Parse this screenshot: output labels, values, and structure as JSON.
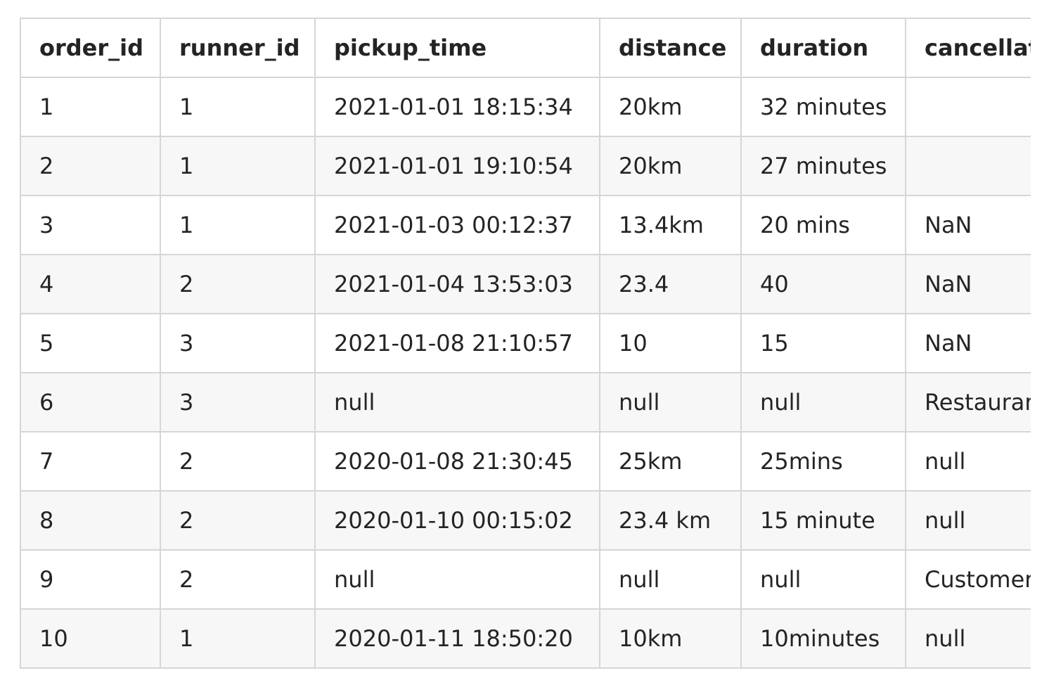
{
  "table": {
    "headers": [
      "order_id",
      "runner_id",
      "pickup_time",
      "distance",
      "duration",
      "cancellat"
    ],
    "rows": [
      [
        "1",
        "1",
        "2021-01-01 18:15:34",
        "20km",
        "32 minutes",
        ""
      ],
      [
        "2",
        "1",
        "2021-01-01 19:10:54",
        "20km",
        "27 minutes",
        ""
      ],
      [
        "3",
        "1",
        "2021-01-03 00:12:37",
        "13.4km",
        "20 mins",
        "NaN"
      ],
      [
        "4",
        "2",
        "2021-01-04 13:53:03",
        "23.4",
        "40",
        "NaN"
      ],
      [
        "5",
        "3",
        "2021-01-08 21:10:57",
        "10",
        "15",
        "NaN"
      ],
      [
        "6",
        "3",
        "null",
        "null",
        "null",
        "Restaurar"
      ],
      [
        "7",
        "2",
        "2020-01-08 21:30:45",
        "25km",
        "25mins",
        "null"
      ],
      [
        "8",
        "2",
        "2020-01-10 00:15:02",
        "23.4 km",
        "15 minute",
        "null"
      ],
      [
        "9",
        "2",
        "null",
        "null",
        "null",
        "Customer"
      ],
      [
        "10",
        "1",
        "2020-01-11 18:50:20",
        "10km",
        "10minutes",
        "null"
      ]
    ]
  },
  "colors": {
    "border": "#d6d6d6",
    "stripe": "#f7f7f7",
    "text": "#242424"
  }
}
